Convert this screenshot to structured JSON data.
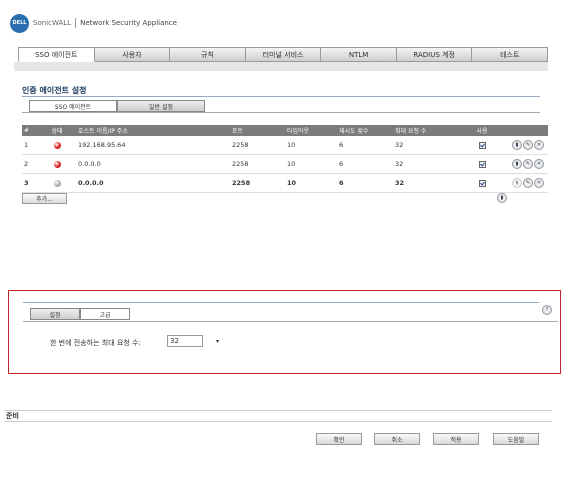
{
  "header": {
    "logo_text": "DELL",
    "brand": "SonicWALL",
    "product": "Network Security Appliance"
  },
  "tabs": [
    {
      "label": "SSO 에이전트",
      "active": true
    },
    {
      "label": "사용자",
      "active": false
    },
    {
      "label": "규칙",
      "active": false
    },
    {
      "label": "터미널 서비스",
      "active": false
    },
    {
      "label": "NTLM",
      "active": false
    },
    {
      "label": "RADIUS 계정",
      "active": false
    },
    {
      "label": "테스트",
      "active": false
    }
  ],
  "section": {
    "title": "인증 에이전트 설정",
    "subtabs": [
      {
        "label": "SSO 에이전트",
        "active": true
      },
      {
        "label": "일반 설정",
        "active": false
      }
    ]
  },
  "table": {
    "headers": {
      "num": "#",
      "status": "상태",
      "host": "호스트 이름/IP 주소",
      "port": "포트",
      "timeout": "타임아웃",
      "retry": "재시도 횟수",
      "max": "최대 요청 수",
      "use": "사용"
    },
    "rows": [
      {
        "num": "1",
        "status_color": "#d81b1b",
        "host": "192.168.95.64",
        "port": "2258",
        "timeout": "10",
        "retry": "6",
        "max": "32",
        "bold": false,
        "enabled": true
      },
      {
        "num": "2",
        "status_color": "#d81b1b",
        "host": "0.0.0.0",
        "port": "2258",
        "timeout": "10",
        "retry": "6",
        "max": "32",
        "bold": false,
        "enabled": true
      },
      {
        "num": "3",
        "status_color": "#a8a8a8",
        "host": "0.0.0.0",
        "port": "2258",
        "timeout": "10",
        "retry": "6",
        "max": "32",
        "bold": true,
        "enabled": true
      }
    ]
  },
  "add_label": "추가...",
  "panel": {
    "tabs": [
      {
        "label": "설정",
        "active": false
      },
      {
        "label": "고급",
        "active": true
      }
    ],
    "field_label": "한 번에 전송하는 최대 요청 수:",
    "field_value": "32"
  },
  "status_text": "준비",
  "footer": {
    "ok": "확인",
    "cancel": "취소",
    "apply": "적용",
    "help": "도움말"
  },
  "icons": {
    "stats": "bar-chart-icon",
    "edit": "pencil-icon",
    "delete": "x-icon",
    "help": "help-icon"
  }
}
